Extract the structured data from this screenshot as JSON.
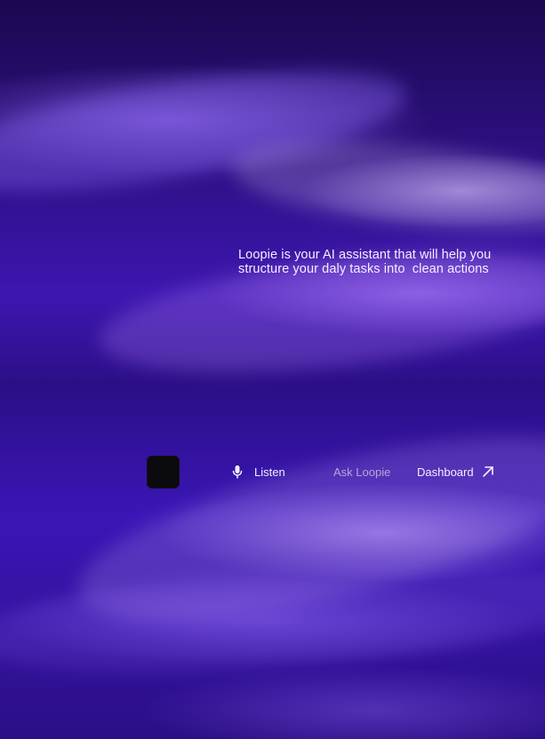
{
  "hero": {
    "tagline": {
      "line1": "Loopie is your AI assistant that will help you",
      "line2": "structure your daly tasks into  clean actions"
    }
  },
  "controls": {
    "listen_label": "Listen",
    "ask_label": "Ask Loopie",
    "dashboard_label": "Dashboard"
  },
  "icons": {
    "mic": "mic-icon",
    "external": "arrow-up-right-icon"
  },
  "colors": {
    "text": "#f4efff",
    "muted": "#b7a6d9",
    "square": "#0b0a0f"
  }
}
